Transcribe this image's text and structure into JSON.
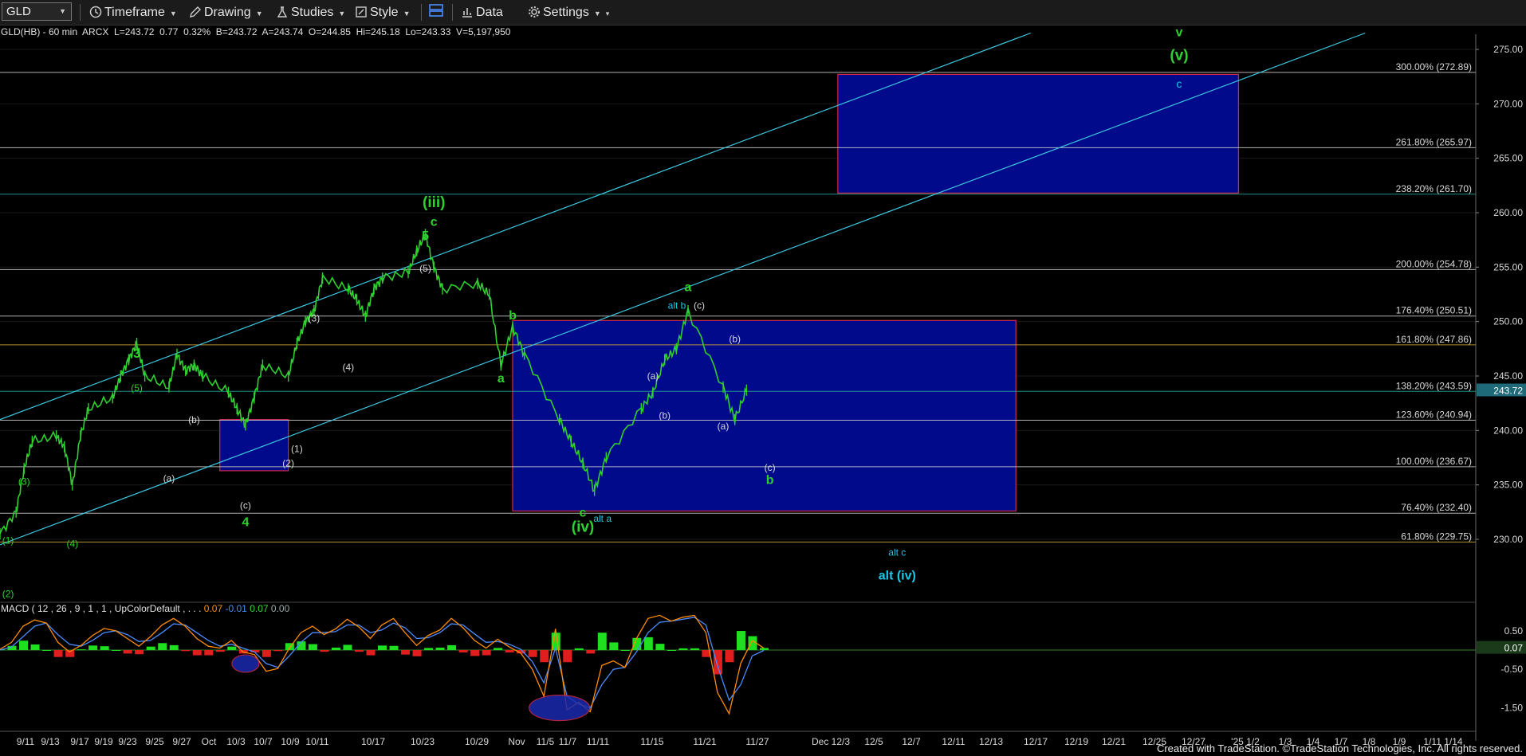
{
  "toolbar": {
    "symbol": "GLD",
    "items": [
      "Timeframe",
      "Drawing",
      "Studies",
      "Style",
      "Data",
      "Settings"
    ]
  },
  "header": {
    "info_line": "GLD(HB) - 60 min  ARCX  L=243.72  0.77  0.32%  B=243.72  A=243.74  O=244.85  Hi=245.18  Lo=243.33  V=5,197,950"
  },
  "macd_header": {
    "label": "MACD ( 12 , 26 , 9 , 1 , 1 , UpColorDefault , . . .",
    "macd": "0.07",
    "signal": "-0.01",
    "hist": "0.07",
    "zero": "0.00"
  },
  "footer": "Created with TradeStation. ©TradeStation Technologies, Inc. All rights reserved.",
  "colors": {
    "background": "#000000",
    "price": "#2ed12e",
    "green_label": "#2ed12e",
    "cyan_label": "#19c8e6",
    "white_label": "#d8d8d8",
    "box_fill": "#000a8a",
    "box_border": "#d02a4a",
    "channel": "#3cc6e0",
    "last_price_tag": "#1e6a78",
    "macd_line": "#ff8c00",
    "signal_line": "#4a8cff",
    "hist_up": "#1ee01e",
    "hist_down": "#e01e1e"
  },
  "chart_data": {
    "type": "line",
    "title": "GLD(HB) - 60 min",
    "ylim": [
      225,
      277
    ],
    "y_ticks": [
      "230.00",
      "235.00",
      "240.00",
      "245.00",
      "250.00",
      "255.00",
      "260.00",
      "265.00",
      "270.00",
      "275.00"
    ],
    "last_price": "243.72",
    "x_ticks": [
      "9/11",
      "9/13",
      "9/17",
      "9/19",
      "9/23",
      "9/25",
      "9/27",
      "Oct",
      "10/3",
      "10/7",
      "10/9",
      "10/11",
      "10/17",
      "10/23",
      "10/29",
      "Nov",
      "11/5",
      "11/7",
      "11/11",
      "11/15",
      "11/21",
      "11/27",
      "Dec 12/3",
      "12/5",
      "12/7",
      "12/11",
      "12/13",
      "12/17",
      "12/19",
      "12/21",
      "12/25",
      "12/27",
      "'25 1/2",
      "1/3",
      "1/4",
      "1/7",
      "1/8",
      "1/9",
      "1/11 1/14"
    ],
    "price_series": [
      {
        "date": "9/9",
        "close": 230.5
      },
      {
        "date": "9/11",
        "close": 232.5
      },
      {
        "date": "9/12",
        "close": 236.5
      },
      {
        "date": "9/13",
        "close": 239
      },
      {
        "date": "9/16",
        "close": 239.5
      },
      {
        "date": "9/17",
        "close": 238.5
      },
      {
        "date": "9/18",
        "close": 235
      },
      {
        "date": "9/19",
        "close": 239.5
      },
      {
        "date": "9/20",
        "close": 242
      },
      {
        "date": "9/23",
        "close": 243
      },
      {
        "date": "9/24",
        "close": 245
      },
      {
        "date": "9/25",
        "close": 246.5
      },
      {
        "date": "9/26",
        "close": 248
      },
      {
        "date": "9/27",
        "close": 245
      },
      {
        "date": "9/30",
        "close": 244
      },
      {
        "date": "10/1",
        "close": 247
      },
      {
        "date": "10/2",
        "close": 245.5
      },
      {
        "date": "10/3",
        "close": 246
      },
      {
        "date": "10/4",
        "close": 245
      },
      {
        "date": "10/7",
        "close": 243.5
      },
      {
        "date": "10/8",
        "close": 242
      },
      {
        "date": "10/9",
        "close": 240.5
      },
      {
        "date": "10/10",
        "close": 243
      },
      {
        "date": "10/11",
        "close": 246
      },
      {
        "date": "10/14",
        "close": 245
      },
      {
        "date": "10/15",
        "close": 248
      },
      {
        "date": "10/16",
        "close": 250
      },
      {
        "date": "10/17",
        "close": 251
      },
      {
        "date": "10/18",
        "close": 254
      },
      {
        "date": "10/21",
        "close": 253
      },
      {
        "date": "10/22",
        "close": 252
      },
      {
        "date": "10/23",
        "close": 250.5
      },
      {
        "date": "10/24",
        "close": 253
      },
      {
        "date": "10/25",
        "close": 254
      },
      {
        "date": "10/28",
        "close": 254.5
      },
      {
        "date": "10/29",
        "close": 256.5
      },
      {
        "date": "10/30",
        "close": 258
      },
      {
        "date": "10/31",
        "close": 255
      },
      {
        "date": "11/1",
        "close": 253
      },
      {
        "date": "11/4",
        "close": 253.5
      },
      {
        "date": "11/5",
        "close": 252.5
      },
      {
        "date": "11/6",
        "close": 246
      },
      {
        "date": "11/7",
        "close": 249.5
      },
      {
        "date": "11/8",
        "close": 247
      },
      {
        "date": "11/11",
        "close": 241
      },
      {
        "date": "11/12",
        "close": 239
      },
      {
        "date": "11/13",
        "close": 237
      },
      {
        "date": "11/14",
        "close": 234.5
      },
      {
        "date": "11/15",
        "close": 237.5
      },
      {
        "date": "11/18",
        "close": 242
      },
      {
        "date": "11/19",
        "close": 243.5
      },
      {
        "date": "11/20",
        "close": 246.5
      },
      {
        "date": "11/21",
        "close": 247.5
      },
      {
        "date": "11/22",
        "close": 251
      },
      {
        "date": "11/25",
        "close": 244
      },
      {
        "date": "11/26",
        "close": 241
      },
      {
        "date": "11/27",
        "close": 243.7
      }
    ],
    "fib_levels": [
      {
        "label": "300.00% (272.89)",
        "value": 272.89,
        "color": "#cfcfcf"
      },
      {
        "label": "261.80% (265.97)",
        "value": 265.97,
        "color": "#cfcfcf"
      },
      {
        "label": "238.20% (261.70)",
        "value": 261.7,
        "color": "#27a89c"
      },
      {
        "label": "200.00% (254.78)",
        "value": 254.78,
        "color": "#cfcfcf"
      },
      {
        "label": "176.40% (250.51)",
        "value": 250.51,
        "color": "#cfcfcf"
      },
      {
        "label": "161.80% (247.86)",
        "value": 247.86,
        "color": "#d8a838"
      },
      {
        "label": "138.20% (243.59)",
        "value": 243.59,
        "color": "#27a89c"
      },
      {
        "label": "123.60% (240.94)",
        "value": 240.94,
        "color": "#cfcfcf"
      },
      {
        "label": "100.00% (236.67)",
        "value": 236.67,
        "color": "#cfcfcf"
      },
      {
        "label": "76.40% (232.40)",
        "value": 232.4,
        "color": "#cfcfcf"
      },
      {
        "label": "61.80% (229.75)",
        "value": 229.75,
        "color": "#d8a838"
      }
    ],
    "boxes": [
      {
        "name": "upper-target-box",
        "from": "12/4",
        "to": "12/31",
        "top": 272.7,
        "bottom": 261.8
      },
      {
        "name": "middle-support-box",
        "from": "11/7",
        "to": "12/16",
        "top": 250.1,
        "bottom": 232.6
      },
      {
        "name": "wave4-box",
        "from": "10/6",
        "to": "10/14",
        "top": 241,
        "bottom": 236.3
      }
    ],
    "channels": [
      {
        "name": "channel-upper",
        "x0": "9/9",
        "y0": 241,
        "x1": "12/17",
        "y1": 276.5
      },
      {
        "name": "channel-lower",
        "x0": "9/9",
        "y0": 229.5,
        "x1": "1/9",
        "y1": 276.5
      }
    ],
    "wave_labels": [
      {
        "text": "v",
        "x": "12/27",
        "y": 276.2,
        "color": "green",
        "size": "l"
      },
      {
        "text": "(v)",
        "x": "12/27",
        "y": 274,
        "color": "green",
        "size": "xl"
      },
      {
        "text": "c",
        "x": "12/27",
        "y": 271.5,
        "color": "cyan",
        "size": "m"
      },
      {
        "text": "(iii)",
        "x": "10/31",
        "y": 260.5,
        "color": "green",
        "size": "xl"
      },
      {
        "text": "c",
        "x": "10/31",
        "y": 258.8,
        "color": "green",
        "size": "l"
      },
      {
        "text": "5",
        "x": "10/30",
        "y": 257.5,
        "color": "green",
        "size": "l"
      },
      {
        "text": "(5)",
        "x": "10/30",
        "y": 254.6,
        "color": "white",
        "size": "s"
      },
      {
        "text": "(3)",
        "x": "10/17",
        "y": 250,
        "color": "white",
        "size": "s"
      },
      {
        "text": "(4)",
        "x": "10/21",
        "y": 245.5,
        "color": "white",
        "size": "s"
      },
      {
        "text": "3",
        "x": "9/26",
        "y": 246.7,
        "color": "green",
        "size": "l"
      },
      {
        "text": "(5)",
        "x": "9/26",
        "y": 243.6,
        "color": "green",
        "size": "s"
      },
      {
        "text": "(b)",
        "x": "10/3",
        "y": 240.7,
        "color": "white",
        "size": "s"
      },
      {
        "text": "(a)",
        "x": "9/30",
        "y": 235.3,
        "color": "white",
        "size": "s"
      },
      {
        "text": "(1)",
        "x": "10/15",
        "y": 238,
        "color": "white",
        "size": "s"
      },
      {
        "text": "(2)",
        "x": "10/14",
        "y": 236.7,
        "color": "white",
        "size": "s"
      },
      {
        "text": "(c)",
        "x": "10/9",
        "y": 232.8,
        "color": "white",
        "size": "s"
      },
      {
        "text": "4",
        "x": "10/9",
        "y": 231.2,
        "color": "green",
        "size": "l"
      },
      {
        "text": "(3)",
        "x": "9/12",
        "y": 235,
        "color": "green",
        "size": "s"
      },
      {
        "text": "(1)",
        "x": "9/10",
        "y": 229.6,
        "color": "green",
        "size": "s"
      },
      {
        "text": "(4)",
        "x": "9/18",
        "y": 229.3,
        "color": "green",
        "size": "s"
      },
      {
        "text": "(2)",
        "x": "9/10",
        "y": 224.7,
        "color": "green",
        "size": "s"
      },
      {
        "text": "b",
        "x": "11/7",
        "y": 250.2,
        "color": "green",
        "size": "l"
      },
      {
        "text": "a",
        "x": "11/6",
        "y": 244.4,
        "color": "green",
        "size": "l"
      },
      {
        "text": "a",
        "x": "11/22",
        "y": 252.8,
        "color": "green",
        "size": "l"
      },
      {
        "text": "alt b",
        "x": "11/22",
        "y": 251.2,
        "color": "cyan",
        "size": "s"
      },
      {
        "text": "(c)",
        "x": "11/22",
        "y": 251.2,
        "color": "white",
        "size": "s"
      },
      {
        "text": "(b)",
        "x": "11/26",
        "y": 248.1,
        "color": "white",
        "size": "s"
      },
      {
        "text": "(a)",
        "x": "11/19",
        "y": 244.7,
        "color": "white",
        "size": "s"
      },
      {
        "text": "(b)",
        "x": "11/20",
        "y": 241.1,
        "color": "white",
        "size": "s"
      },
      {
        "text": "(a)",
        "x": "11/25",
        "y": 240.1,
        "color": "white",
        "size": "s"
      },
      {
        "text": "(c)",
        "x": "11/29",
        "y": 236.3,
        "color": "white",
        "size": "s"
      },
      {
        "text": "b",
        "x": "11/29",
        "y": 235.1,
        "color": "green",
        "size": "l"
      },
      {
        "text": "c",
        "x": "11/13",
        "y": 232.1,
        "color": "green",
        "size": "l"
      },
      {
        "text": "(iv)",
        "x": "11/13",
        "y": 230.7,
        "color": "green",
        "size": "xl"
      },
      {
        "text": "alt a",
        "x": "11/14",
        "y": 231.6,
        "color": "cyan",
        "size": "s"
      },
      {
        "text": "alt c",
        "x": "12/8",
        "y": 228.5,
        "color": "cyan",
        "size": "s"
      },
      {
        "text": "alt (iv)",
        "x": "12/8",
        "y": 226.3,
        "color": "cyan",
        "size": "l"
      }
    ],
    "macd": {
      "ylim": [
        -1.9,
        0.95
      ],
      "y_ticks": [
        "0.50",
        "-0.50",
        "-1.50"
      ],
      "last_value": "0.07",
      "macd_series": [
        0.02,
        0.2,
        0.62,
        0.78,
        0.7,
        0.2,
        -0.05,
        0.12,
        0.38,
        0.56,
        0.5,
        0.3,
        0.1,
        0.35,
        0.65,
        0.82,
        0.62,
        0.3,
        0.1,
        0.05,
        0.25,
        -0.05,
        -0.12,
        -0.55,
        -0.48,
        0.05,
        0.45,
        0.62,
        0.4,
        0.55,
        0.8,
        0.6,
        0.3,
        0.65,
        0.82,
        0.45,
        0.12,
        0.38,
        0.52,
        0.82,
        0.58,
        0.25,
        0.05,
        0.28,
        0.08,
        -0.08,
        -0.5,
        -1.2,
        0.55,
        -1.55,
        -1.35,
        -1.6,
        -0.4,
        -0.28,
        -0.45,
        0.3,
        0.82,
        0.9,
        0.75,
        0.85,
        0.9,
        0.45,
        -1.1,
        -1.65,
        -0.35,
        0.25,
        0.05
      ],
      "signal_series": [
        0.0,
        0.08,
        0.35,
        0.62,
        0.7,
        0.4,
        0.15,
        0.1,
        0.25,
        0.45,
        0.5,
        0.4,
        0.22,
        0.25,
        0.45,
        0.68,
        0.65,
        0.45,
        0.25,
        0.1,
        0.15,
        0.05,
        -0.05,
        -0.35,
        -0.45,
        -0.15,
        0.2,
        0.45,
        0.45,
        0.48,
        0.65,
        0.65,
        0.45,
        0.52,
        0.7,
        0.58,
        0.3,
        0.32,
        0.45,
        0.68,
        0.65,
        0.42,
        0.2,
        0.22,
        0.15,
        0.02,
        -0.3,
        -0.85,
        0.05,
        -1.2,
        -1.4,
        -1.5,
        -0.9,
        -0.5,
        -0.45,
        -0.05,
        0.45,
        0.72,
        0.75,
        0.8,
        0.85,
        0.65,
        -0.4,
        -1.3,
        -0.9,
        -0.15,
        -0.01
      ],
      "highlight_ellipses": [
        {
          "date": "10/9",
          "value": -0.35
        },
        {
          "date": "11/11",
          "value": -1.5
        }
      ]
    }
  }
}
